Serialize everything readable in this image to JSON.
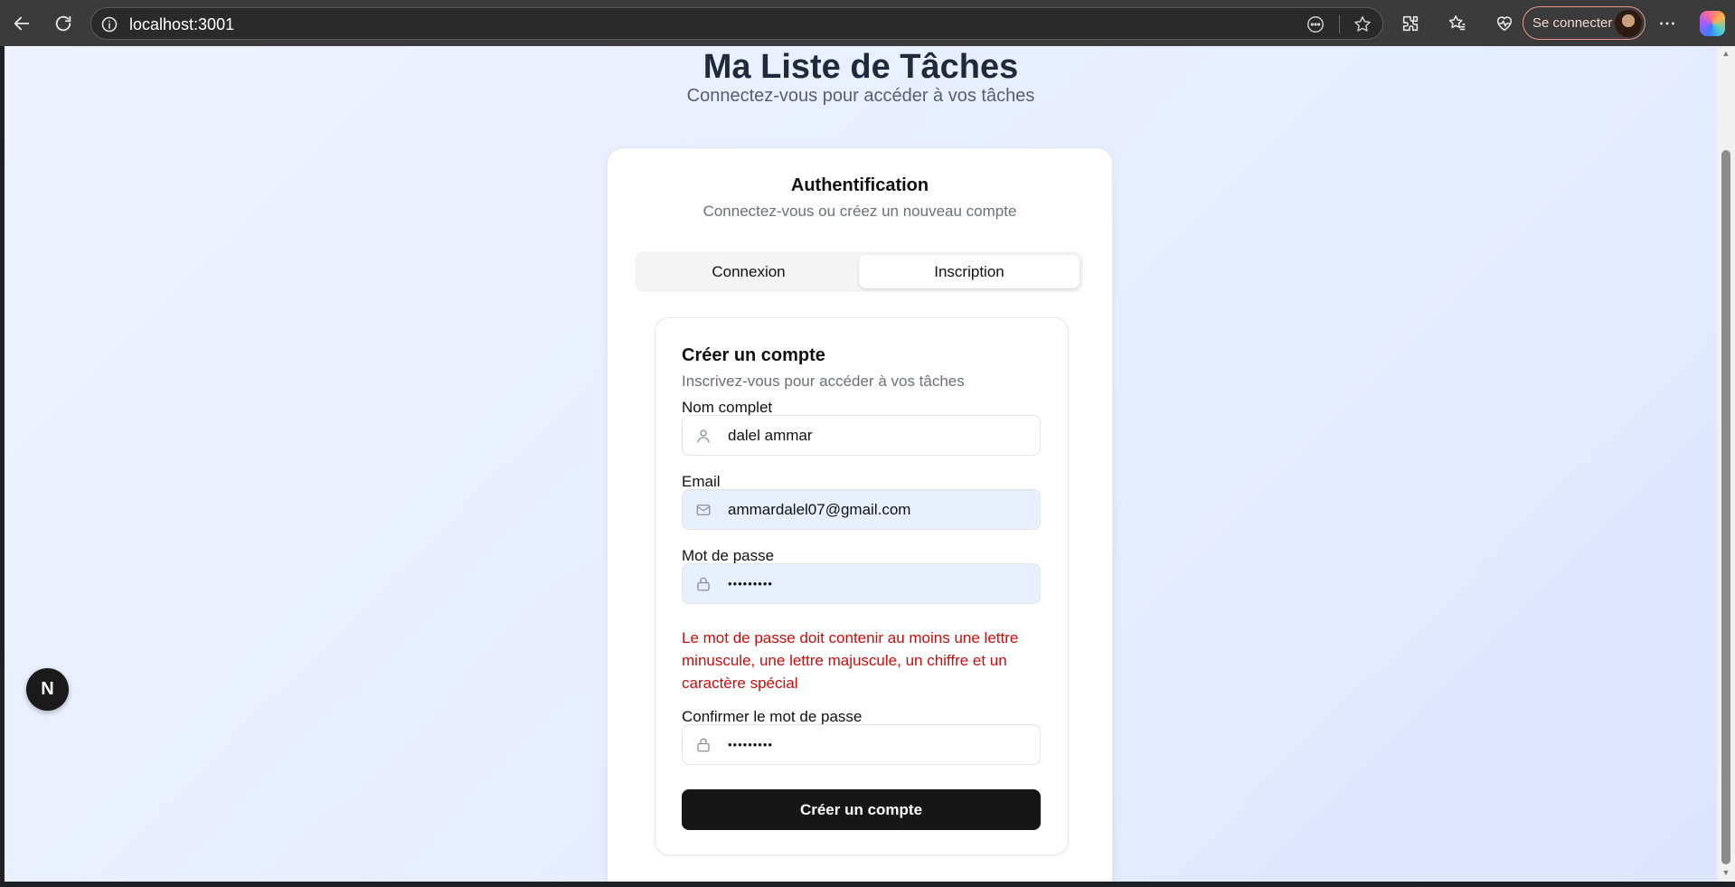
{
  "browser": {
    "url": "localhost:3001",
    "profile_label": "Se connecter",
    "icons": [
      "back-icon",
      "reload-icon",
      "info-icon",
      "reader-mode-icon",
      "favorite-star-icon",
      "extensions-icon",
      "favorites-icon",
      "browser-essentials-icon",
      "more-icon",
      "copilot-icon"
    ]
  },
  "page": {
    "title": "Ma Liste de Tâches",
    "subtitle": "Connectez-vous pour accéder à vos tâches"
  },
  "auth": {
    "title": "Authentification",
    "subtitle": "Connectez-vous ou créez un nouveau compte",
    "tabs": [
      {
        "label": "Connexion",
        "active": false
      },
      {
        "label": "Inscription",
        "active": true
      }
    ]
  },
  "form": {
    "title": "Créer un compte",
    "subtitle": "Inscrivez-vous pour accéder à vos tâches",
    "name": {
      "label": "Nom complet",
      "value": "dalel ammar",
      "icon": "user-icon"
    },
    "email": {
      "label": "Email",
      "value": "ammardalel07@gmail.com",
      "icon": "mail-icon"
    },
    "password": {
      "label": "Mot de passe",
      "value": "•••••••••",
      "icon": "lock-icon"
    },
    "password_error": "Le mot de passe doit contenir au moins une lettre minuscule, une lettre majuscule, un chiffre et un caractère spécial",
    "confirm": {
      "label": "Confirmer le mot de passe",
      "value": "•••••••••",
      "icon": "lock-icon"
    },
    "submit_label": "Créer un compte"
  },
  "dev_badge": {
    "label": "N"
  },
  "colors": {
    "error": "#d10a0a",
    "primary_button": "#161616",
    "autofill_bg": "#e8f0fe",
    "profile_border": "#e79a88"
  }
}
